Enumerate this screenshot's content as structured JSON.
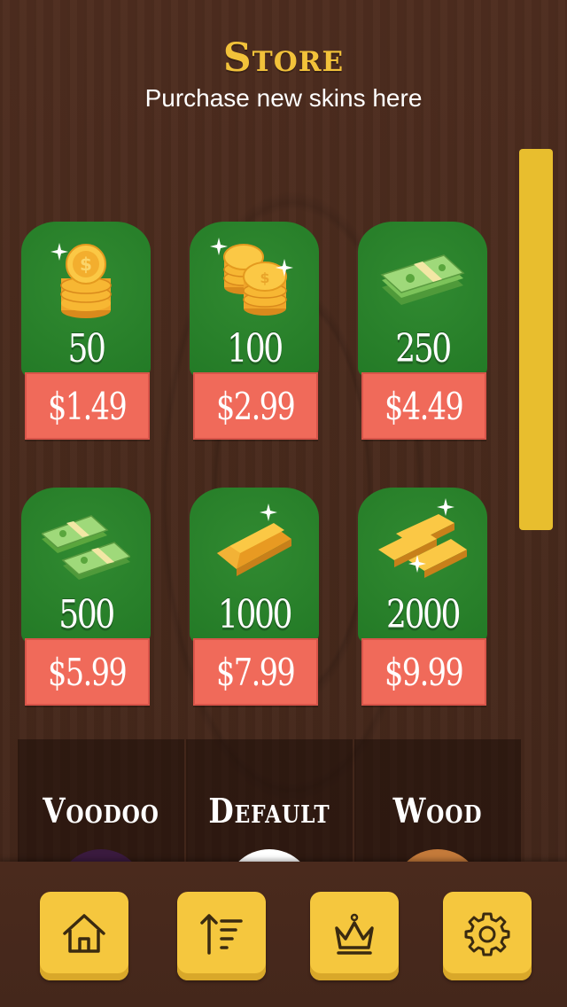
{
  "header": {
    "title": "Store",
    "subtitle": "Purchase new skins here"
  },
  "store_items": [
    {
      "amount": "50",
      "price": "$1.49",
      "icon": "coin-stack-icon"
    },
    {
      "amount": "100",
      "price": "$2.99",
      "icon": "coin-stacks-icon"
    },
    {
      "amount": "250",
      "price": "$4.49",
      "icon": "cash-bundle-icon"
    },
    {
      "amount": "500",
      "price": "$5.99",
      "icon": "cash-bundles-icon"
    },
    {
      "amount": "1000",
      "price": "$7.99",
      "icon": "gold-bar-icon"
    },
    {
      "amount": "2000",
      "price": "$9.99",
      "icon": "gold-bars-icon"
    }
  ],
  "skins": [
    {
      "label": "Voodoo",
      "swatch_color": "#3a1a3e"
    },
    {
      "label": "Default",
      "swatch_color": "#ffffff"
    },
    {
      "label": "Wood",
      "swatch_color": "#c47a3a"
    }
  ],
  "nav": [
    {
      "name": "home",
      "icon": "home-icon"
    },
    {
      "name": "leaderboard",
      "icon": "sort-icon"
    },
    {
      "name": "store",
      "icon": "crown-icon"
    },
    {
      "name": "settings",
      "icon": "gear-icon"
    }
  ],
  "colors": {
    "accent": "#f2c23a",
    "card_green": "#2a7f2b",
    "price_red": "#f06a5a",
    "nav_yellow": "#f5c73e"
  }
}
